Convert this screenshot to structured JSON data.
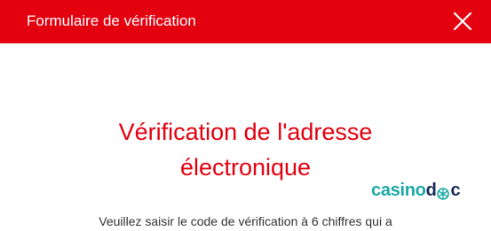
{
  "modal": {
    "title": "Formulaire de vérification",
    "close_icon": "close-icon"
  },
  "content": {
    "heading_line1": "Vérification de l'adresse",
    "heading_line2": "électronique",
    "instructions": "Veuillez saisir le code de vérification à 6 chiffres qui a"
  },
  "logo": {
    "text_part1": "casino",
    "text_part2": "d",
    "icon": "snowflake-icon",
    "text_part3": "c"
  },
  "colors": {
    "accent": "#e3000f",
    "header_text": "#ffffff",
    "logo_teal": "#1da9a6",
    "logo_navy": "#1a2a5a",
    "body_text": "#333333"
  }
}
